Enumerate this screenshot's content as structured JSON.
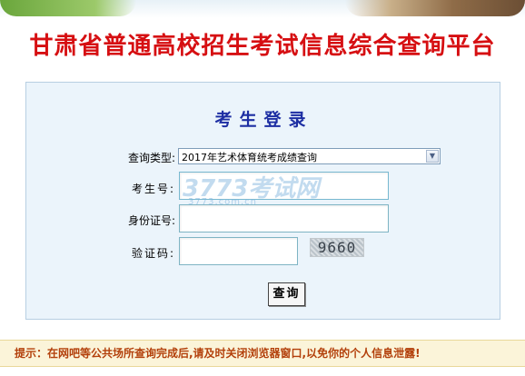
{
  "header": {
    "site_title": "甘肃省普通高校招生考试信息综合查询平台"
  },
  "login": {
    "title": "考生登录",
    "query_type_label": "查询类型:",
    "query_type_value": "2017年艺术体育统考成绩查询",
    "exam_number_label": "考生号:",
    "exam_number_value": "",
    "id_number_label": "身份证号:",
    "id_number_value": "",
    "captcha_label": "验证码:",
    "captcha_value": "",
    "captcha_image_text": "9660",
    "submit_label": "查询"
  },
  "watermark": {
    "main": "3773考试网",
    "sub": "3773.com.cn"
  },
  "notice": {
    "text": "提示：在网吧等公共场所查询完成后,请及时关闭浏览器窗口,以免你的个人信息泄露!"
  },
  "colors": {
    "title_red": "#d60f12",
    "login_title_blue": "#1d2ea3",
    "panel_bg": "#ebf4fb",
    "notice_text": "#b3400b",
    "notice_bg": "#fbf4d9"
  }
}
